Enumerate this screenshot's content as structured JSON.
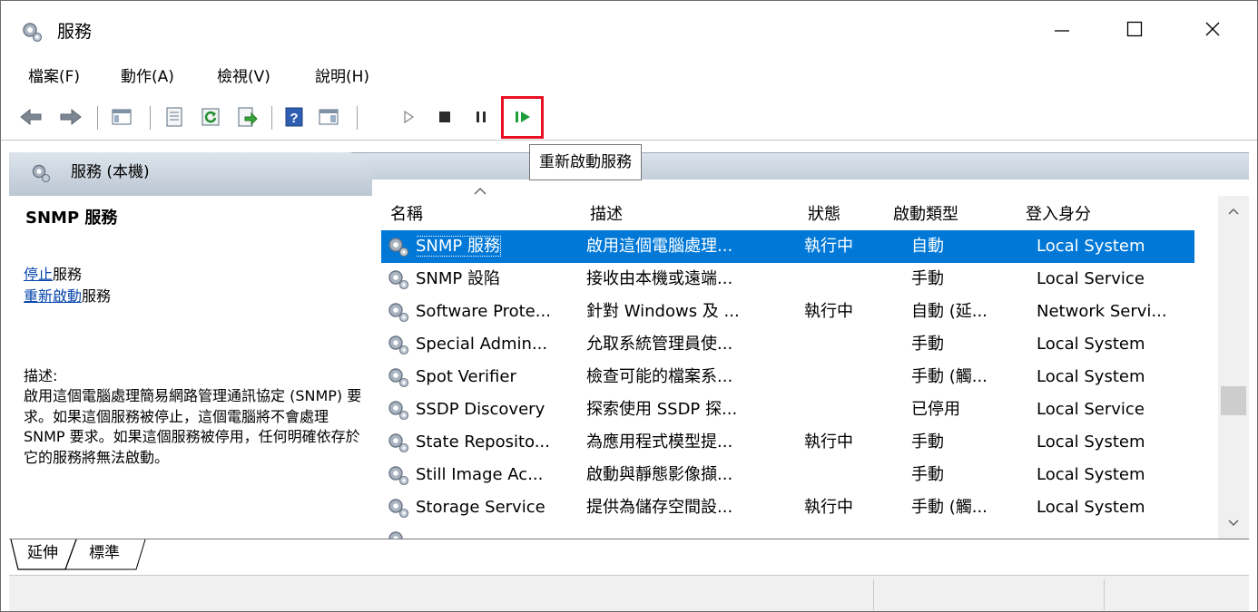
{
  "window": {
    "title": "服務",
    "minimize_icon": "minimize-icon",
    "maximize_icon": "maximize-icon",
    "close_icon": "close-icon"
  },
  "menu": {
    "items": [
      {
        "label": "檔案(F)"
      },
      {
        "label": "動作(A)"
      },
      {
        "label": "檢視(V)"
      },
      {
        "label": "說明(H)"
      }
    ]
  },
  "toolbar": {
    "buttons": [
      {
        "name": "back-icon"
      },
      {
        "name": "forward-icon"
      },
      {
        "name": "show-hide-console-tree-icon"
      },
      {
        "name": "properties-icon"
      },
      {
        "name": "refresh-icon"
      },
      {
        "name": "export-list-icon"
      },
      {
        "name": "help-icon"
      },
      {
        "name": "show-hide-action-pane-icon"
      },
      {
        "name": "start-service-icon"
      },
      {
        "name": "stop-service-icon"
      },
      {
        "name": "pause-service-icon"
      },
      {
        "name": "restart-service-icon"
      }
    ],
    "tooltip": "重新啟動服務",
    "highlight_color": "#e81123"
  },
  "left_pane": {
    "header": "服務 (本機)",
    "service_name": "SNMP 服務",
    "actions": [
      {
        "link": "停止",
        "suffix": "服務"
      },
      {
        "link": "重新啟動",
        "suffix": "服務"
      }
    ],
    "description_label": "描述:",
    "description": "啟用這個電腦處理簡易網路管理通訊協定 (SNMP) 要求。如果這個服務被停止，這個電腦將不會處理 SNMP 要求。如果這個服務被停用，任何明確依存於它的服務將無法啟動。"
  },
  "list": {
    "columns": {
      "name": "名稱",
      "description": "描述",
      "status": "狀態",
      "startup": "啟動類型",
      "logon": "登入身分"
    },
    "selection_color": "#0078d7",
    "rows": [
      {
        "name": "SNMP 服務",
        "description": "啟用這個電腦處理...",
        "status": "執行中",
        "startup": "自動",
        "logon": "Local System",
        "selected": true
      },
      {
        "name": "SNMP 設陷",
        "description": "接收由本機或遠端...",
        "status": "",
        "startup": "手動",
        "logon": "Local Service"
      },
      {
        "name": "Software Prote...",
        "description": "針對 Windows 及 ...",
        "status": "執行中",
        "startup": "自動 (延...",
        "logon": "Network Servi..."
      },
      {
        "name": "Special Admin...",
        "description": "允取系統管理員使...",
        "status": "",
        "startup": "手動",
        "logon": "Local System"
      },
      {
        "name": "Spot Verifier",
        "description": "檢查可能的檔案系...",
        "status": "",
        "startup": "手動 (觸...",
        "logon": "Local System"
      },
      {
        "name": "SSDP Discovery",
        "description": "探索使用 SSDP 探...",
        "status": "",
        "startup": "已停用",
        "logon": "Local Service"
      },
      {
        "name": "State Reposito...",
        "description": "為應用程式模型提...",
        "status": "執行中",
        "startup": "手動",
        "logon": "Local System"
      },
      {
        "name": "Still Image Ac...",
        "description": "啟動與靜態影像擷...",
        "status": "",
        "startup": "手動",
        "logon": "Local System"
      },
      {
        "name": "Storage Service",
        "description": "提供為儲存空間設...",
        "status": "執行中",
        "startup": "手動 (觸...",
        "logon": "Local System"
      },
      {
        "name": "",
        "description": "",
        "status": "",
        "startup": "",
        "logon": ""
      }
    ]
  },
  "tabs": [
    {
      "label": "延伸"
    },
    {
      "label": "標準"
    }
  ]
}
